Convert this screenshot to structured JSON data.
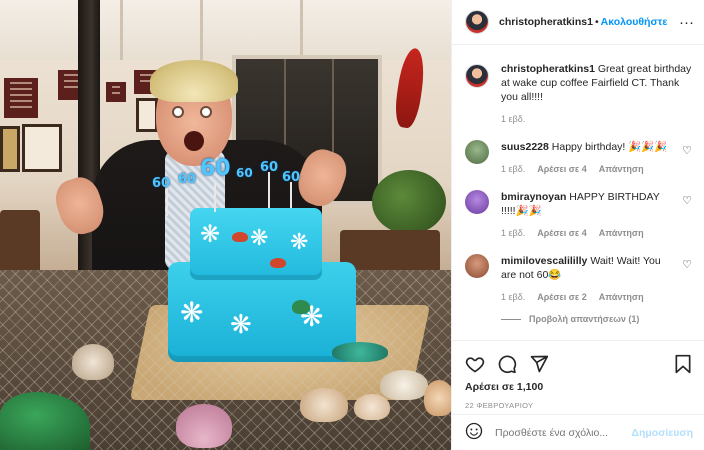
{
  "post": {
    "username": "christopheratkins1",
    "dot": "•",
    "follow_label": "Ακολουθήστε",
    "more": "···"
  },
  "caption": {
    "username": "christopheratkins1",
    "text": "Great great birthday at wake cup coffee Fairfield CT. Thank you all!!!!",
    "time": "1 εβδ."
  },
  "comments": [
    {
      "username": "suus2228",
      "text": "Happy birthday! 🎉🎉🎉",
      "time": "1 εβδ.",
      "likes": "Αρέσει σε 4",
      "reply": "Απάντηση",
      "avatar_color": "#7a9a6a"
    },
    {
      "username": "bmiraynoyan",
      "text": "HAPPY BIRTHDAY !!!!!🎉🎉",
      "time": "1 εβδ.",
      "likes": "Αρέσει σε 4",
      "reply": "Απάντηση",
      "avatar_color": "#8e5ac8"
    },
    {
      "username": "mimilovescalililly",
      "text": "Wait! Wait! You are not 60😂",
      "time": "1 εβδ.",
      "likes": "Αρέσει σε 2",
      "reply": "Απάντηση",
      "avatar_color": "#b56d4d"
    }
  ],
  "view_replies": "Προβολή απαντήσεων (1)",
  "actions": {
    "likes_text": "Αρέσει σε 1,100",
    "date": "22 ΦΕΒΡΟΥΑΡΙΟΥ"
  },
  "add_comment": {
    "placeholder": "Προσθέστε ένα σχόλιο...",
    "post_label": "Δημοσίευση"
  },
  "photo": {
    "candles": [
      "60",
      "60",
      "60",
      "60",
      "60",
      "60"
    ]
  },
  "colors": {
    "follow": "#0095f6",
    "post_disabled": "#b2dffc",
    "cake": "#2ec4e6"
  }
}
